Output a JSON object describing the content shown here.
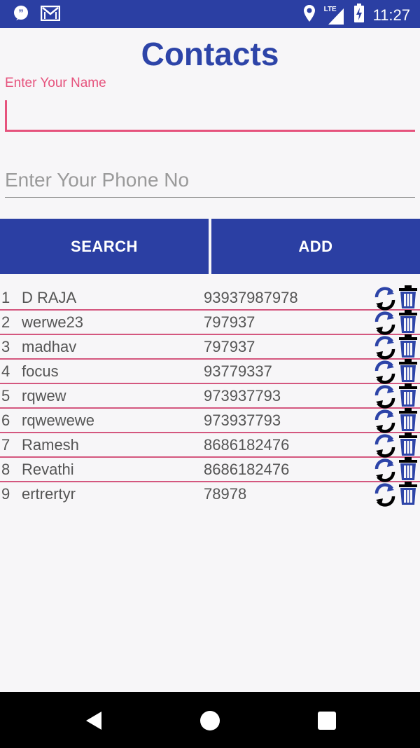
{
  "status_bar": {
    "time": "11:27",
    "network_label": "LTE",
    "icons": [
      "quote-notification-icon",
      "gmail-icon",
      "location-icon",
      "signal-icon",
      "battery-charging-icon"
    ]
  },
  "app": {
    "title": "Contacts",
    "name_field": {
      "label": "Enter Your Name",
      "value": ""
    },
    "phone_field": {
      "placeholder": "Enter Your Phone No",
      "value": ""
    },
    "buttons": {
      "search": "SEARCH",
      "add": "ADD"
    },
    "colors": {
      "primary": "#2b3fa3",
      "accent": "#e6537d",
      "row_divider": "#d4577f"
    },
    "contacts": [
      {
        "index": "1",
        "name": "D RAJA",
        "phone": "93937987978"
      },
      {
        "index": "2",
        "name": "werwe23",
        "phone": "797937"
      },
      {
        "index": "3",
        "name": "madhav",
        "phone": "797937"
      },
      {
        "index": "4",
        "name": "focus",
        "phone": "93779337"
      },
      {
        "index": "5",
        "name": "rqwew",
        "phone": "973937793"
      },
      {
        "index": "6",
        "name": "rqwewewe",
        "phone": "973937793"
      },
      {
        "index": "7",
        "name": "Ramesh",
        "phone": "8686182476"
      },
      {
        "index": "8",
        "name": "Revathi",
        "phone": "8686182476"
      },
      {
        "index": "9",
        "name": "ertrertyr",
        "phone": "78978"
      }
    ]
  },
  "nav_bar": {
    "icons": [
      "back-icon",
      "home-icon",
      "recent-apps-icon"
    ]
  }
}
